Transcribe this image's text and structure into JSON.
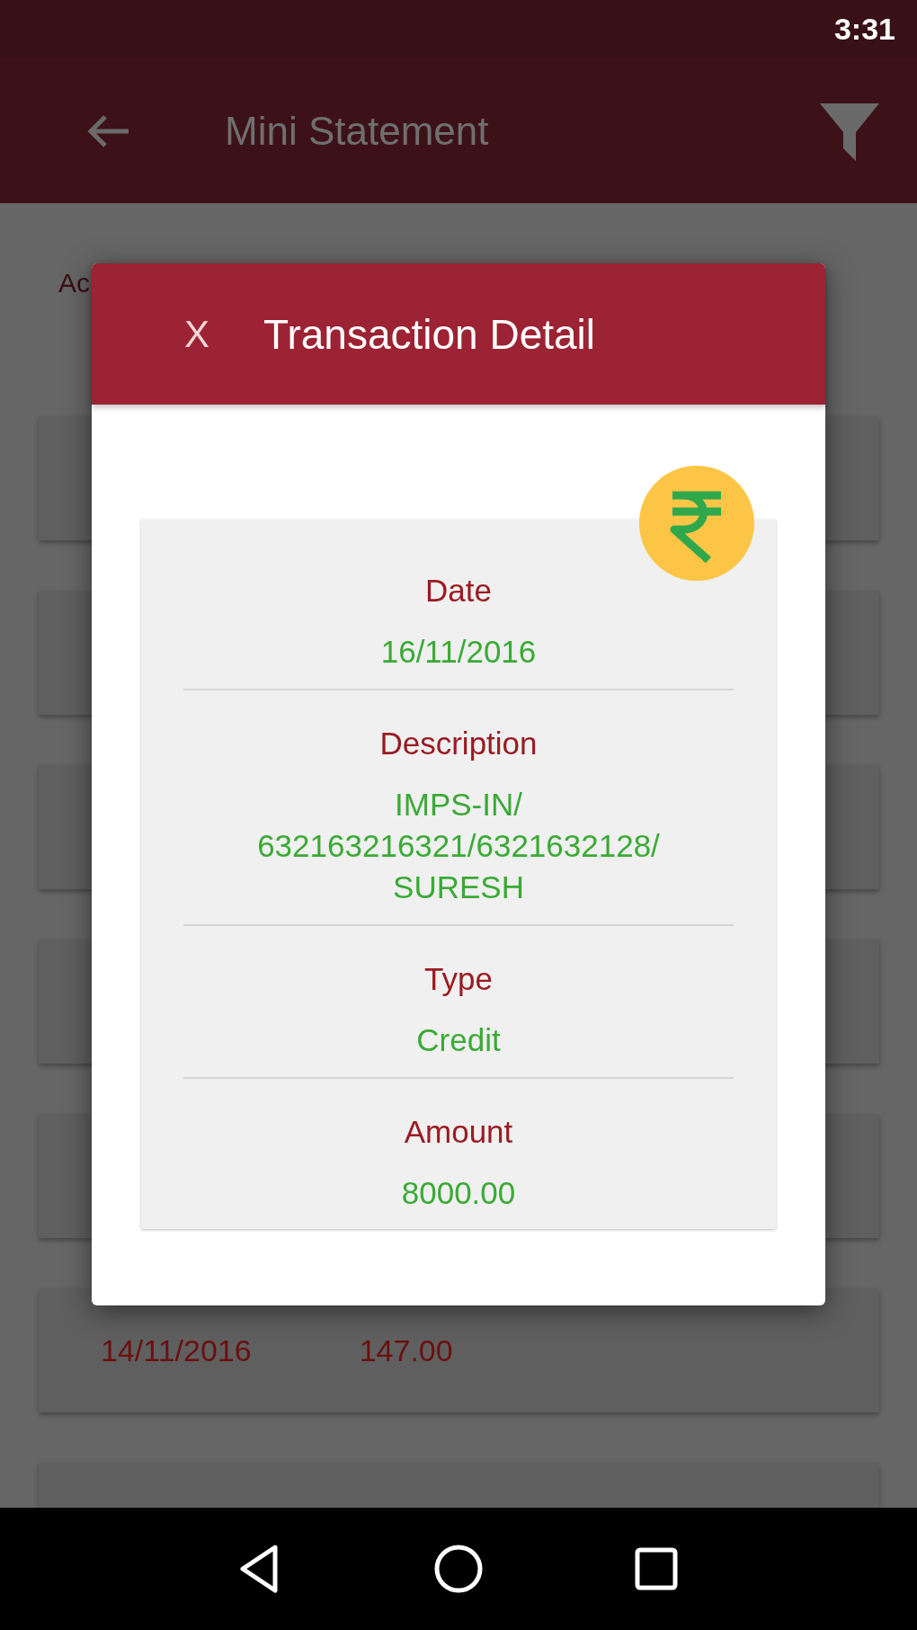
{
  "status_bar": {
    "time": "3:31"
  },
  "app_bar": {
    "title": "Mini Statement"
  },
  "account_label": "Ac",
  "transactions": [
    {
      "date": "14/11/2016",
      "amount": "147.00"
    }
  ],
  "dialog": {
    "close_label": "X",
    "title": "Transaction Detail",
    "fields": [
      {
        "label": "Date",
        "value": "16/11/2016"
      },
      {
        "label": "Description",
        "value": "IMPS-IN/\n632163216321/6321632128/\nSURESH"
      },
      {
        "label": "Type",
        "value": "Credit"
      },
      {
        "label": "Amount",
        "value": "8000.00"
      }
    ]
  }
}
